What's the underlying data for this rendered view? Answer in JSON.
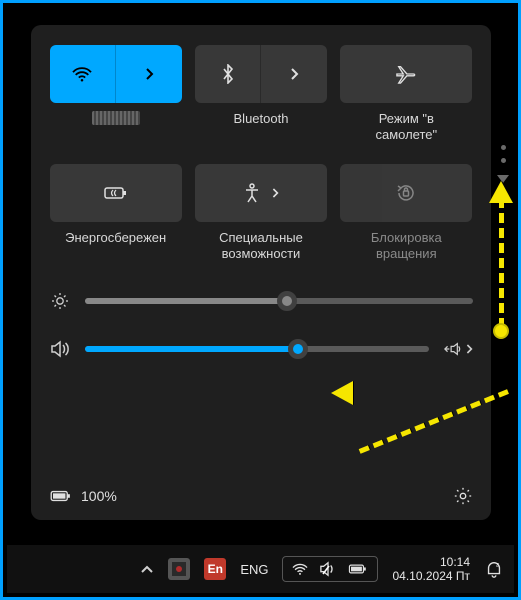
{
  "tiles": {
    "wifi": {
      "label_redacted": true
    },
    "bluetooth": {
      "label": "Bluetooth"
    },
    "airplane": {
      "label": "Режим \"в\nсамолете\""
    },
    "battery": {
      "label": "Энергосбережен"
    },
    "access": {
      "label": "Специальные\nвозможности"
    },
    "rotation": {
      "label": "Блокировка\nвращения"
    }
  },
  "sliders": {
    "brightness": {
      "percent": 52
    },
    "volume": {
      "percent": 62
    }
  },
  "footer": {
    "battery_text": "100%"
  },
  "taskbar": {
    "lang_badge": "En",
    "lang_text": "ENG",
    "time": "10:14",
    "date": "04.10.2024 Пт"
  },
  "colors": {
    "accent": "#00a8ff",
    "annotation": "#f6e600"
  }
}
